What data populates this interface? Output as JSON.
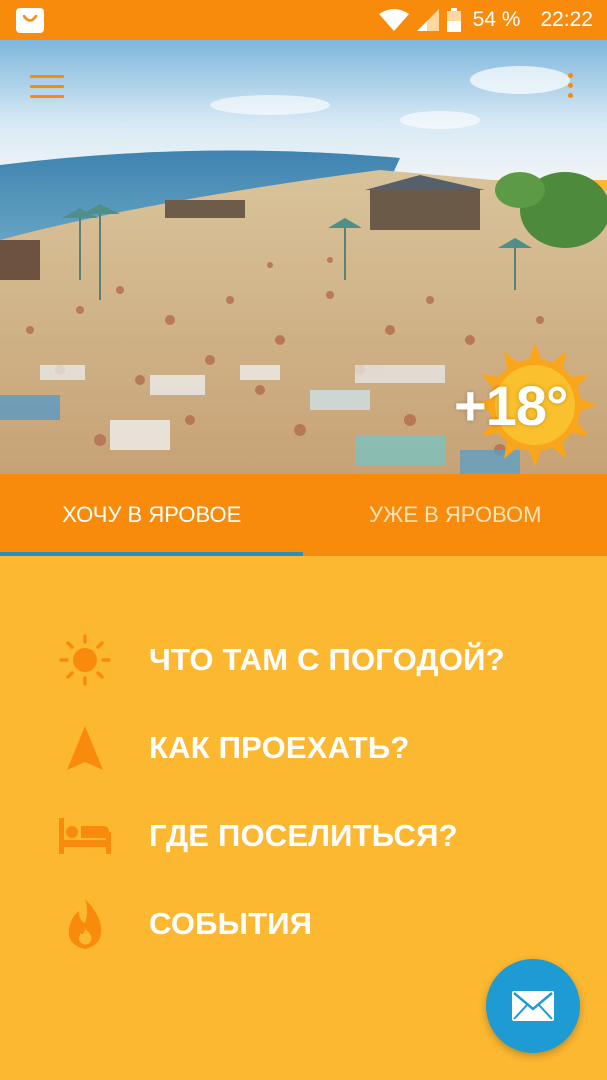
{
  "status_bar": {
    "battery_percent": "54 %",
    "time": "22:22",
    "icons": [
      "shop-bag-icon",
      "wifi-icon",
      "signal-icon",
      "battery-icon"
    ]
  },
  "hero": {
    "temperature": "+18°",
    "icons": [
      "hamburger-menu-icon",
      "more-vert-icon"
    ]
  },
  "tabs": [
    {
      "label": "ХОЧУ В ЯРОВОЕ",
      "active": true
    },
    {
      "label": "УЖЕ В ЯРОВОМ",
      "active": false
    }
  ],
  "menu": [
    {
      "label": "ЧТО ТАМ С ПОГОДОЙ?",
      "icon": "sun-icon"
    },
    {
      "label": "КАК ПРОЕХАТЬ?",
      "icon": "navigation-arrow-icon"
    },
    {
      "label": "ГДЕ ПОСЕЛИТЬСЯ?",
      "icon": "bed-icon"
    },
    {
      "label": "СОБЫТИЯ",
      "icon": "fire-icon"
    }
  ],
  "fab": {
    "icon": "mail-icon"
  },
  "colors": {
    "primary": "#F98B0C",
    "background": "#FDB831",
    "tab_indicator": "#2E8DB8",
    "fab": "#1E9BD2",
    "text": "#FFFFFF"
  }
}
